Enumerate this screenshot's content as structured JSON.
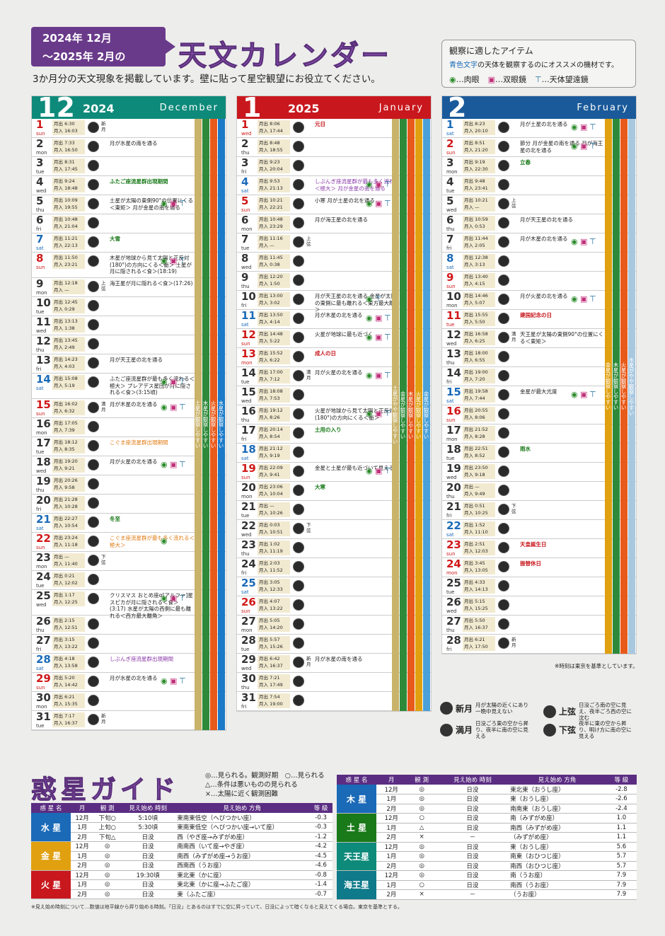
{
  "header": {
    "badge_line1": "2024年 12月",
    "badge_line2": "～2025年 2月の",
    "title": "天文カレンダー",
    "subtitle": "3か月分の天文現象を掲載しています。壁に貼って星空観望にお役立てください。"
  },
  "items_box": {
    "title": "観察に適したアイテム",
    "desc_blue": "青色文字",
    "desc_rest": "の天体を観察するのにオススメの機材です。",
    "naked": "…肉眼",
    "binoculars": "…双眼鏡",
    "telescope": "…天体望遠鏡"
  },
  "months": [
    {
      "num": "12",
      "year": "2024",
      "en": "December",
      "color": "#0e8a7a",
      "days": [
        {
          "d": "1",
          "w": "sun",
          "rise": "6:30",
          "set": "16:03",
          "phase": "新月",
          "ev": ""
        },
        {
          "d": "2",
          "w": "mon",
          "rise": "7:33",
          "set": "16:50",
          "ev": "月が水星の南を通る"
        },
        {
          "d": "3",
          "w": "tue",
          "rise": "8:31",
          "set": "17:45",
          "ev": ""
        },
        {
          "d": "4",
          "w": "wed",
          "rise": "9:24",
          "set": "18:48",
          "ev": "ふたご座流星群出現期間",
          "cls": "sea"
        },
        {
          "d": "5",
          "w": "thu",
          "rise": "10:09",
          "set": "19:55",
          "ev": "土星が太陽の東側90°の位置にくる＜東矩＞ 月が金星の南を通る",
          "icons": "eye bin tel"
        },
        {
          "d": "6",
          "w": "fri",
          "rise": "10:48",
          "set": "21:04",
          "ev": ""
        },
        {
          "d": "7",
          "w": "sat",
          "rise": "11:21",
          "set": "22:13",
          "ev": "大雪",
          "cls": "sea"
        },
        {
          "d": "8",
          "w": "sun",
          "rise": "11:50",
          "set": "23:21",
          "ev": "木星が地球から見て太陽と正反対(180°)の方向にくる＜衝＞ 土星が月に隠される＜食＞(18:19)",
          "icons": "eye bin tel"
        },
        {
          "d": "9",
          "w": "mon",
          "rise": "12:18",
          "set": "—",
          "phase": "上弦",
          "ev": "海王星が月に隠れる＜食＞(17:26)"
        },
        {
          "d": "10",
          "w": "tue",
          "rise": "12:45",
          "set": "0:29",
          "ev": ""
        },
        {
          "d": "11",
          "w": "wed",
          "rise": "13:13",
          "set": "1:38",
          "ev": ""
        },
        {
          "d": "12",
          "w": "thu",
          "rise": "13:45",
          "set": "2:49",
          "ev": ""
        },
        {
          "d": "13",
          "w": "fri",
          "rise": "14:23",
          "set": "4:03",
          "ev": "月が天王星の北を通る"
        },
        {
          "d": "14",
          "w": "sat",
          "rise": "15:08",
          "set": "5:19",
          "ev": "ふたご座流星群が最も多く流れる＜極大＞ プレアデス星団が月に隠される＜食＞(3:15頃)",
          "icons": "eye bin tel"
        },
        {
          "d": "15",
          "w": "sun",
          "rise": "16:02",
          "set": "6:32",
          "phase": "満月",
          "ev": "月が木星の北を通る",
          "icons": "eye bin tel"
        },
        {
          "d": "16",
          "w": "mon",
          "rise": "17:05",
          "set": "7:39",
          "ev": ""
        },
        {
          "d": "17",
          "w": "tue",
          "rise": "18:12",
          "set": "8:35",
          "ev": "こぐま座流星群出現期間",
          "cls": "met2"
        },
        {
          "d": "18",
          "w": "wed",
          "rise": "19:20",
          "set": "9:21",
          "ev": "月が火星の北を通る",
          "icons": "eye bin tel"
        },
        {
          "d": "19",
          "w": "thu",
          "rise": "20:26",
          "set": "9:58",
          "ev": ""
        },
        {
          "d": "20",
          "w": "fri",
          "rise": "21:28",
          "set": "10:28",
          "ev": ""
        },
        {
          "d": "21",
          "w": "sat",
          "rise": "22:27",
          "set": "10:54",
          "ev": "冬至",
          "cls": "sea"
        },
        {
          "d": "22",
          "w": "sun",
          "rise": "23:24",
          "set": "11:18",
          "ev": "こぐま座流星群が最も多く流れる＜極大＞",
          "cls": "met2",
          "icons": "eye"
        },
        {
          "d": "23",
          "w": "mon",
          "rise": "—",
          "set": "11:40",
          "phase": "下弦",
          "ev": ""
        },
        {
          "d": "24",
          "w": "tue",
          "rise": "0:21",
          "set": "12:02",
          "ev": ""
        },
        {
          "d": "25",
          "w": "wed",
          "rise": "1:17",
          "set": "12:25",
          "ev": "クリスマス おとめ座α[アルファ]星スピカが月に隠される＜食＞(3:17) 水星が太陽の西側に最も離れる＜西方最大離角＞",
          "icons": "eye bin tel"
        },
        {
          "d": "26",
          "w": "thu",
          "rise": "2:15",
          "set": "12:51",
          "ev": ""
        },
        {
          "d": "27",
          "w": "fri",
          "rise": "3:15",
          "set": "13:22",
          "ev": ""
        },
        {
          "d": "28",
          "w": "sat",
          "rise": "4:18",
          "set": "13:58",
          "ev": "しぶんぎ座流星群出現期間",
          "cls": "met"
        },
        {
          "d": "29",
          "w": "sun",
          "rise": "5:20",
          "set": "14:42",
          "ev": "月が水星の北を通る",
          "icons": "eye bin tel"
        },
        {
          "d": "30",
          "w": "mon",
          "rise": "6:21",
          "set": "15:35",
          "ev": ""
        },
        {
          "d": "31",
          "w": "tue",
          "rise": "7:17",
          "set": "16:37",
          "phase": "新月",
          "ev": ""
        }
      ]
    },
    {
      "num": "1",
      "year": "2025",
      "en": "January",
      "color": "#c8181e",
      "days": [
        {
          "d": "1",
          "w": "wed",
          "rise": "8:06",
          "set": "17:44",
          "ev": "元日",
          "cls": "hol"
        },
        {
          "d": "2",
          "w": "thu",
          "rise": "8:48",
          "set": "18:55",
          "ev": ""
        },
        {
          "d": "3",
          "w": "fri",
          "rise": "9:23",
          "set": "20:04",
          "ev": ""
        },
        {
          "d": "4",
          "w": "sat",
          "rise": "9:53",
          "set": "21:13",
          "ev": "しぶんぎ座流星群が最も多く流れる＜極大＞ 月が金星の南を通る",
          "cls": "met",
          "icons": "eye bin tel"
        },
        {
          "d": "5",
          "w": "sun",
          "rise": "10:21",
          "set": "22:21",
          "ev": "小寒 月が土星の北を通る",
          "icons": "eye bin tel"
        },
        {
          "d": "6",
          "w": "mon",
          "rise": "10:48",
          "set": "23:29",
          "ev": "月が海王星の北を通る"
        },
        {
          "d": "7",
          "w": "tue",
          "rise": "11:16",
          "set": "—",
          "phase": "上弦",
          "ev": ""
        },
        {
          "d": "8",
          "w": "wed",
          "rise": "11:45",
          "set": "0:38",
          "ev": ""
        },
        {
          "d": "9",
          "w": "thu",
          "rise": "12:20",
          "set": "1:50",
          "ev": ""
        },
        {
          "d": "10",
          "w": "fri",
          "rise": "13:00",
          "set": "3:02",
          "ev": "月が天王星の北を通る 金星が太陽の東側に最も離れる＜東方最大離角＞",
          "icons": "eye tel"
        },
        {
          "d": "11",
          "w": "sat",
          "rise": "13:50",
          "set": "4:14",
          "ev": "月が木星の北を通る",
          "icons": "eye bin tel"
        },
        {
          "d": "12",
          "w": "sun",
          "rise": "14:48",
          "set": "5:22",
          "ev": "火星が地球に最も近づく",
          "icons": "eye bin tel"
        },
        {
          "d": "13",
          "w": "mon",
          "rise": "15:52",
          "set": "6:22",
          "ev": "成人の日",
          "cls": "hol"
        },
        {
          "d": "14",
          "w": "tue",
          "rise": "17:00",
          "set": "7:12",
          "phase": "満月",
          "ev": "月が火星の北を通る",
          "icons": "eye bin tel"
        },
        {
          "d": "15",
          "w": "wed",
          "rise": "18:08",
          "set": "7:53",
          "ev": ""
        },
        {
          "d": "16",
          "w": "thu",
          "rise": "19:12",
          "set": "8:26",
          "ev": "火星が地球から見て太陽と正反対(180°)の方向にくる＜衝＞",
          "icons": "eye bin tel"
        },
        {
          "d": "17",
          "w": "fri",
          "rise": "20:14",
          "set": "8:54",
          "ev": "土用の入り",
          "cls": "sea"
        },
        {
          "d": "18",
          "w": "sat",
          "rise": "21:12",
          "set": "9:19",
          "ev": ""
        },
        {
          "d": "19",
          "w": "sun",
          "rise": "22:09",
          "set": "9:41",
          "ev": "金星と土星が最も近づいて見える",
          "icons": "eye bin tel"
        },
        {
          "d": "20",
          "w": "mon",
          "rise": "23:06",
          "set": "10:04",
          "ev": "大寒",
          "cls": "sea"
        },
        {
          "d": "21",
          "w": "tue",
          "rise": "—",
          "set": "10:26",
          "ev": ""
        },
        {
          "d": "22",
          "w": "wed",
          "rise": "0:03",
          "set": "10:51",
          "phase": "下弦",
          "ev": ""
        },
        {
          "d": "23",
          "w": "thu",
          "rise": "1:02",
          "set": "11:19",
          "ev": ""
        },
        {
          "d": "24",
          "w": "fri",
          "rise": "2:03",
          "set": "11:52",
          "ev": ""
        },
        {
          "d": "25",
          "w": "sat",
          "rise": "3:05",
          "set": "12:33",
          "ev": ""
        },
        {
          "d": "26",
          "w": "sun",
          "rise": "4:07",
          "set": "13:22",
          "ev": ""
        },
        {
          "d": "27",
          "w": "mon",
          "rise": "5:05",
          "set": "14:20",
          "ev": ""
        },
        {
          "d": "28",
          "w": "tue",
          "rise": "5:57",
          "set": "15:26",
          "ev": ""
        },
        {
          "d": "29",
          "w": "wed",
          "rise": "6:42",
          "set": "16:37",
          "phase": "新月",
          "ev": "月が水星の南を通る"
        },
        {
          "d": "30",
          "w": "thu",
          "rise": "7:21",
          "set": "17:49",
          "ev": ""
        },
        {
          "d": "31",
          "w": "fri",
          "rise": "7:54",
          "set": "19:00",
          "ev": ""
        }
      ]
    },
    {
      "num": "2",
      "year": "",
      "en": "February",
      "color": "#1a5a9a",
      "days": [
        {
          "d": "1",
          "w": "sat",
          "rise": "8:23",
          "set": "20:10",
          "ev": "月が土星の北を通る",
          "icons": "eye bin tel"
        },
        {
          "d": "2",
          "w": "sun",
          "rise": "8:51",
          "set": "21:20",
          "ev": "節分 月が金星の南を通る 月が海王星の北を通る",
          "icons": "eye bin tel"
        },
        {
          "d": "3",
          "w": "mon",
          "rise": "9:19",
          "set": "22:30",
          "ev": "立春",
          "cls": "sea"
        },
        {
          "d": "4",
          "w": "tue",
          "rise": "9:48",
          "set": "23:41",
          "ev": ""
        },
        {
          "d": "5",
          "w": "wed",
          "rise": "10:21",
          "set": "—",
          "phase": "上弦",
          "ev": ""
        },
        {
          "d": "6",
          "w": "thu",
          "rise": "10:59",
          "set": "0:53",
          "ev": "月が天王星の北を通る"
        },
        {
          "d": "7",
          "w": "fri",
          "rise": "11:44",
          "set": "2:05",
          "ev": "月が木星の北を通る",
          "icons": "eye bin tel"
        },
        {
          "d": "8",
          "w": "sat",
          "rise": "12:38",
          "set": "3:13",
          "ev": ""
        },
        {
          "d": "9",
          "w": "sun",
          "rise": "13:40",
          "set": "4:15",
          "ev": ""
        },
        {
          "d": "10",
          "w": "mon",
          "rise": "14:46",
          "set": "5:07",
          "ev": "月が火星の北を通る",
          "icons": "eye bin tel"
        },
        {
          "d": "11",
          "w": "tue",
          "rise": "15:55",
          "set": "5:50",
          "ev": "建国記念の日",
          "cls": "hol"
        },
        {
          "d": "12",
          "w": "wed",
          "rise": "16:58",
          "set": "6:25",
          "phase": "満月",
          "ev": "天王星が太陽の東側90°の位置にくる＜東矩＞"
        },
        {
          "d": "13",
          "w": "thu",
          "rise": "18:00",
          "set": "6:55",
          "ev": ""
        },
        {
          "d": "14",
          "w": "fri",
          "rise": "19:00",
          "set": "7:20",
          "ev": ""
        },
        {
          "d": "15",
          "w": "sat",
          "rise": "19:58",
          "set": "7:44",
          "ev": "金星が最大光度",
          "icons": "eye bin tel"
        },
        {
          "d": "16",
          "w": "sun",
          "rise": "20:55",
          "set": "8:06",
          "ev": ""
        },
        {
          "d": "17",
          "w": "mon",
          "rise": "21:52",
          "set": "8:28",
          "ev": ""
        },
        {
          "d": "18",
          "w": "tue",
          "rise": "22:51",
          "set": "8:52",
          "ev": "雨水",
          "cls": "sea"
        },
        {
          "d": "19",
          "w": "wed",
          "rise": "23:50",
          "set": "9:18",
          "ev": ""
        },
        {
          "d": "20",
          "w": "thu",
          "rise": "—",
          "set": "9:49",
          "ev": ""
        },
        {
          "d": "21",
          "w": "fri",
          "rise": "0:51",
          "set": "10:25",
          "phase": "下弦",
          "ev": ""
        },
        {
          "d": "22",
          "w": "sat",
          "rise": "1:52",
          "set": "11:10",
          "ev": ""
        },
        {
          "d": "23",
          "w": "sun",
          "rise": "2:51",
          "set": "12:03",
          "ev": "天皇誕生日",
          "cls": "hol"
        },
        {
          "d": "24",
          "w": "mon",
          "rise": "3:45",
          "set": "13:05",
          "ev": "振替休日",
          "cls": "hol"
        },
        {
          "d": "25",
          "w": "tue",
          "rise": "4:33",
          "set": "14:13",
          "ev": ""
        },
        {
          "d": "26",
          "w": "wed",
          "rise": "5:15",
          "set": "15:25",
          "ev": ""
        },
        {
          "d": "27",
          "w": "thu",
          "rise": "5:50",
          "set": "16:37",
          "ev": ""
        },
        {
          "d": "28",
          "w": "fri",
          "rise": "6:21",
          "set": "17:50",
          "phase": "新月",
          "ev": ""
        }
      ]
    }
  ],
  "labels": {
    "rise": "月出",
    "set": "月入"
  },
  "bars": {
    "m12": [
      "土星が観察しやすい",
      "木星が観察しやすい",
      "火星が観察しやすい",
      "水星が観察しやすい"
    ],
    "m1": [
      "土星がやや観察しやすい",
      "金星が観察しやすい",
      "木星が観察しやすい",
      "火星が観察しやすい",
      "金星が観察しやすい"
    ],
    "m2": [
      "金星が観察しやすい",
      "木星が観察しやすい",
      "火星が観察しやすい",
      "水星がやや観察しやすい"
    ]
  },
  "tz_note": "※時刻は東京を基準としています。",
  "moon_legend": [
    {
      "label": "新月",
      "desc": "月が太陽の近くにあり一晩中見えない"
    },
    {
      "label": "上弦",
      "desc": "日没ごろ南の空に見え、夜半ごろ西の空に沈む"
    },
    {
      "label": "満月",
      "desc": "日没ごろ東の空から昇り、夜半に南の空に見える"
    },
    {
      "label": "下弦",
      "desc": "夜半に東の空から昇り、明け方に南の空に見える"
    }
  ],
  "planet_guide": {
    "title": "惑星ガイド",
    "legend": [
      "◎…見られる。観測好期　○…見られる",
      "△…条件は悪いものの見られる",
      "×…太陽に近く観測困難"
    ],
    "headers": [
      "惑 星 名",
      "月",
      "観 測",
      "見え始め 時刻",
      "見え始め 方角",
      "等 級"
    ],
    "left": [
      {
        "name": "水 星",
        "color": "#1a6ab8",
        "rows": [
          [
            "12月",
            "下旬○",
            "5:10頃",
            "東南東低空（へびつかい座）",
            "-0.3"
          ],
          [
            "1月",
            "上旬○",
            "5:30頃",
            "東南東低空（へびつかい座→いて座）",
            "-0.3"
          ],
          [
            "2月",
            "下旬△",
            "日没",
            "西（やぎ座→みずがめ座）",
            "-1.2"
          ]
        ]
      },
      {
        "name": "金 星",
        "color": "#e0a010",
        "rows": [
          [
            "12月",
            "◎",
            "日没",
            "南南西（いて座→やぎ座）",
            "-4.2"
          ],
          [
            "1月",
            "◎",
            "日没",
            "南西（みずがめ座→うお座）",
            "-4.5"
          ],
          [
            "2月",
            "◎",
            "日没",
            "西南西（うお座）",
            "-4.6"
          ]
        ]
      },
      {
        "name": "火 星",
        "color": "#c8181e",
        "rows": [
          [
            "12月",
            "◎",
            "19:30頃",
            "東北東（かに座）",
            "-0.8"
          ],
          [
            "1月",
            "◎",
            "日没",
            "東北東（かに座→ふたご座）",
            "-1.4"
          ],
          [
            "2月",
            "◎",
            "日没",
            "東（ふたご座）",
            "-0.7"
          ]
        ]
      }
    ],
    "right": [
      {
        "name": "木 星",
        "color": "#1a6ab8",
        "rows": [
          [
            "12月",
            "◎",
            "日没",
            "東北東（おうし座）",
            "-2.8"
          ],
          [
            "1月",
            "◎",
            "日没",
            "東（おうし座）",
            "-2.6"
          ],
          [
            "2月",
            "◎",
            "日没",
            "南南東（おうし座）",
            "-2.4"
          ]
        ]
      },
      {
        "name": "土 星",
        "color": "#1a7a1a",
        "rows": [
          [
            "12月",
            "○",
            "日没",
            "南（みずがめ座）",
            "1.0"
          ],
          [
            "1月",
            "△",
            "日没",
            "南西（みずがめ座）",
            "1.1"
          ],
          [
            "2月",
            "×",
            "－",
            "（みずがめ座）",
            "1.1"
          ]
        ]
      },
      {
        "name": "天王星",
        "color": "#0e8a7a",
        "rows": [
          [
            "12月",
            "◎",
            "日没",
            "東（おうし座）",
            "5.6"
          ],
          [
            "1月",
            "◎",
            "日没",
            "南東（おひつじ座）",
            "5.7"
          ],
          [
            "2月",
            "◎",
            "日没",
            "南西（おひつじ座）",
            "5.7"
          ]
        ]
      },
      {
        "name": "海王星",
        "color": "#0e7a8a",
        "rows": [
          [
            "12月",
            "◎",
            "日没",
            "南（うお座）",
            "7.9"
          ],
          [
            "1月",
            "○",
            "日没",
            "南西（うお座）",
            "7.9"
          ],
          [
            "2月",
            "×",
            "－",
            "（うお座）",
            "7.9"
          ]
        ]
      }
    ],
    "footnote": "※見え始め時刻について…数値は地平線から昇り始める時刻。「日没」とあるのはすでに空に昇っていて、日没によって暗くなると見えてくる場合。東京を基準とする。"
  }
}
